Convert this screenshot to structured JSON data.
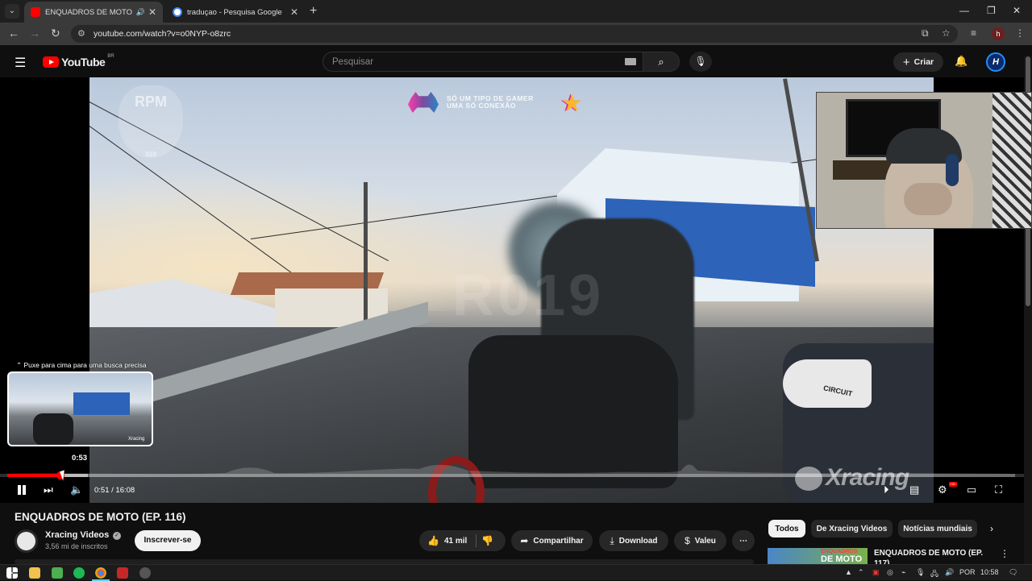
{
  "browser": {
    "tabs": [
      {
        "title": "ENQUADROS DE MOTO (EP.",
        "active": true,
        "favicon": "youtube-icon",
        "audio": true
      },
      {
        "title": "traduçao - Pesquisa Google",
        "active": false,
        "favicon": "google-icon"
      }
    ],
    "url": "youtube.com/watch?v=o0NYP-o8zrc",
    "profile_initial": "h"
  },
  "youtube": {
    "logo_text": "YouTube",
    "country_code": "BR",
    "search_placeholder": "Pesquisar",
    "create_label": "Criar",
    "avatar_letter": "H"
  },
  "player": {
    "promo_line1": "SÓ UM TIPO DE GAMER",
    "promo_line2": "UMA SÓ CONEXÃO",
    "watermark_rpm": "RPM",
    "watermark_rpm_sub": "019",
    "watermark_center": "R019",
    "bike_brand": "CIRCUIT",
    "seek_hint": "⌃ Puxe para cima para uma busca precisa",
    "preview_time": "0:53",
    "current_time": "0:51",
    "duration": "16:08",
    "time_display": "0:51 / 16:08",
    "progress_fraction": 0.053,
    "channel_watermark": "Xracing",
    "hd_badge": "HD"
  },
  "video": {
    "title": "ENQUADROS DE MOTO (EP. 116)",
    "channel": "Xracing Videos",
    "subscribers": "3,56 mi de inscritos",
    "subscribe_label": "Inscrever-se",
    "likes": "41 mil",
    "share_label": "Compartilhar",
    "download_label": "Download",
    "thanks_label": "Valeu"
  },
  "sidebar": {
    "chips": [
      "Todos",
      "De Xracing Videos",
      "Notícias mundiais"
    ],
    "recommendation": {
      "title": "ENQUADROS DE MOTO (EP. 117)",
      "thumb_line1": "ENQUADROS",
      "thumb_line2": "DE MOTO"
    }
  },
  "taskbar": {
    "language": "POR",
    "clock": "10:58"
  },
  "colors": {
    "accent_red": "#ff0000",
    "background": "#0f0f0f",
    "chip_active": "#f1f1f1"
  }
}
